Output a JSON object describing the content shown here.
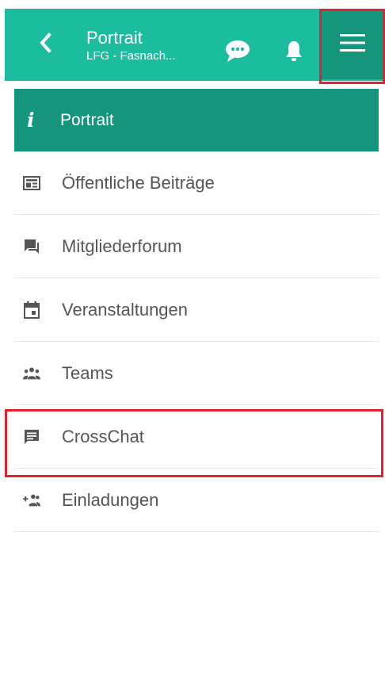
{
  "header": {
    "title": "Portrait",
    "subtitle": "LFG - Fasnach...",
    "back_icon": "chevron-left-icon",
    "chat_icon": "chat-bubble-icon",
    "bell_icon": "bell-icon",
    "menu_icon": "hamburger-menu-icon",
    "background_color": "#1bbd9e",
    "active_color": "#14957c",
    "highlight_color": "#e3222d"
  },
  "nav": {
    "active": {
      "label": "Portrait",
      "icon": "info-icon",
      "glyph": "i"
    },
    "items": [
      {
        "label": "Öffentliche Beiträge",
        "icon": "newspaper-icon"
      },
      {
        "label": "Mitgliederforum",
        "icon": "forum-icon"
      },
      {
        "label": "Veranstaltungen",
        "icon": "calendar-icon"
      },
      {
        "label": "Teams",
        "icon": "group-icon"
      },
      {
        "label": "CrossChat",
        "icon": "message-icon"
      },
      {
        "label": "Einladungen",
        "icon": "add-group-icon"
      }
    ]
  }
}
